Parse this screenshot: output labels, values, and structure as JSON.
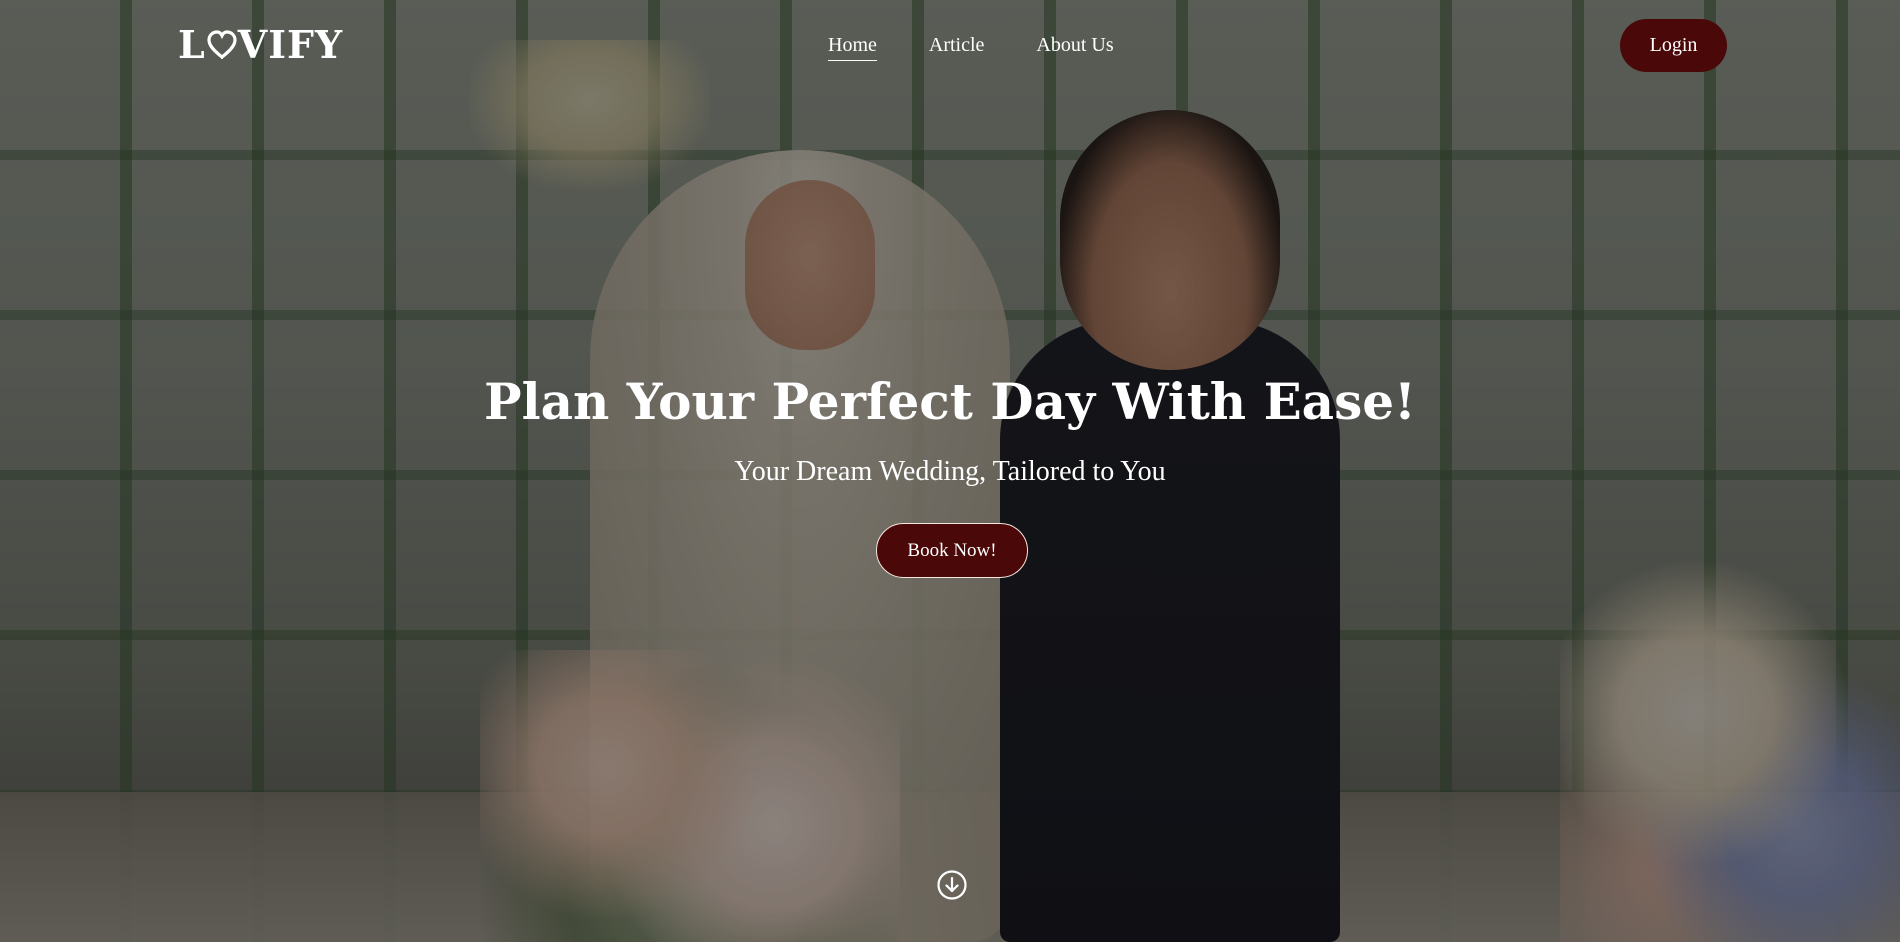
{
  "brand": {
    "logo_text_start": "L",
    "logo_text_end": "VIFY",
    "logo_full": "LOVIFY"
  },
  "nav": {
    "links": [
      {
        "label": "Home",
        "active": true
      },
      {
        "label": "Article",
        "active": false
      },
      {
        "label": "About Us",
        "active": false
      }
    ],
    "login_label": "Login"
  },
  "hero": {
    "title": "Plan Your Perfect Day With Ease!",
    "subtitle": "Your Dream Wedding, Tailored to You",
    "cta_label": "Book Now!",
    "scroll_icon": "arrow-down-circle-icon"
  },
  "colors": {
    "accent": "#4a0808",
    "text": "#ffffff"
  }
}
